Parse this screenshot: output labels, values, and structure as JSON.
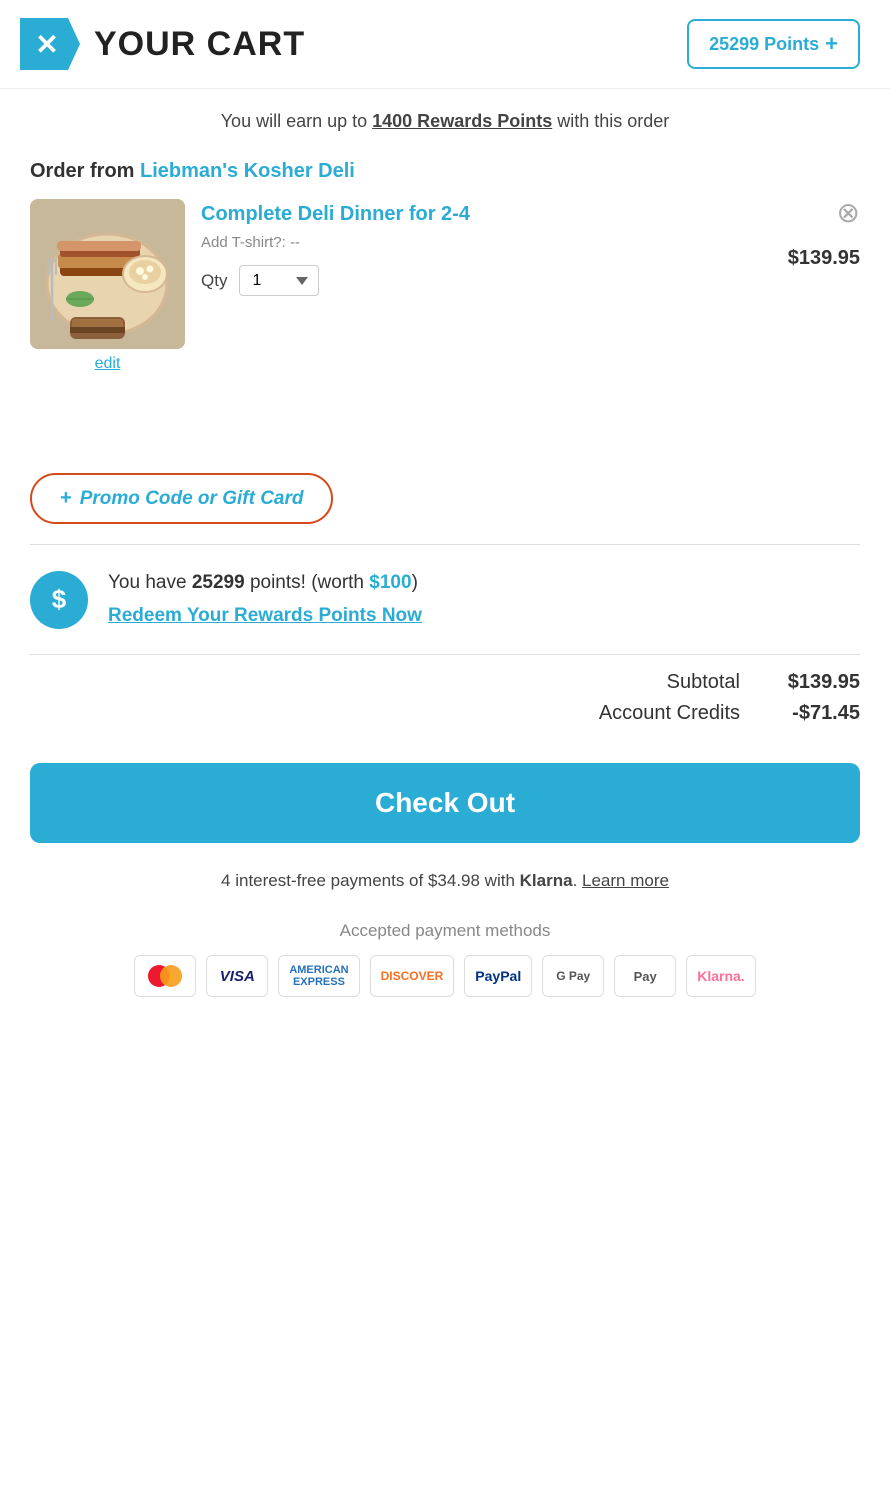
{
  "header": {
    "logo_symbol": "✕",
    "cart_title": "YOUR CART",
    "points_button": "25299 Points"
  },
  "rewards_notice": {
    "prefix": "You will earn up to ",
    "points_link": "1400 Rewards Points",
    "suffix": " with this order"
  },
  "order": {
    "from_label": "Order from ",
    "restaurant_name": "Liebman's Kosher Deli",
    "item": {
      "name": "Complete Deli Dinner for 2-4",
      "addon_label": "Add T-shirt?:",
      "addon_value": "--",
      "qty_label": "Qty",
      "qty_value": "1",
      "price": "$139.95",
      "edit_label": "edit"
    }
  },
  "promo": {
    "plus_icon": "+",
    "label": "Promo Code or Gift Card"
  },
  "rewards_section": {
    "icon": "$",
    "prefix": "You have ",
    "points": "25299",
    "middle": " points! (worth ",
    "worth": "$100",
    "suffix": ")",
    "redeem_label": "Redeem Your Rewards Points Now"
  },
  "totals": {
    "subtotal_label": "Subtotal",
    "subtotal_value": "$139.95",
    "credits_label": "Account Credits",
    "credits_value": "-$71.45"
  },
  "checkout": {
    "button_label": "Check Out"
  },
  "klarna": {
    "text": "4 interest-free payments of $34.98 with ",
    "brand": "Klarna",
    "link_text": "Learn more"
  },
  "payment_methods": {
    "label": "Accepted payment methods",
    "icons": [
      "MC",
      "VISA",
      "AMEX",
      "DISCOVER",
      "PayPal",
      "GPay",
      "Apple Pay",
      "Klarna"
    ]
  }
}
